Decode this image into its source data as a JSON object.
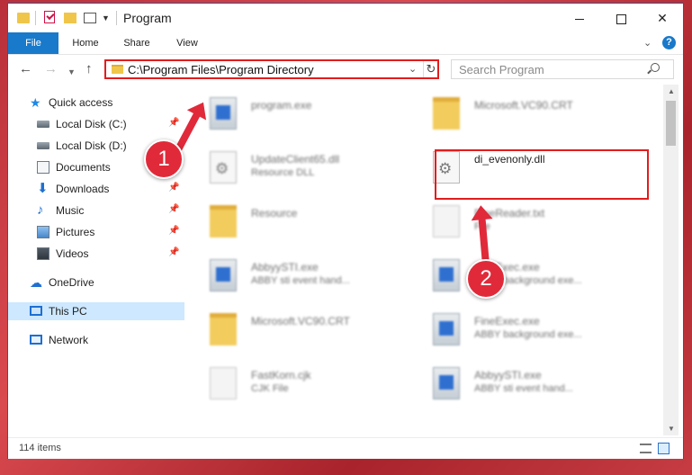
{
  "window": {
    "title": "Program"
  },
  "ribbon": {
    "tabs": [
      "File",
      "Home",
      "Share",
      "View"
    ]
  },
  "navigation": {
    "address": "C:\\Program Files\\Program Directory",
    "search_placeholder": "Search Program"
  },
  "sidebar": {
    "items": [
      {
        "label": "Quick access",
        "icon": "star-icon",
        "pinned": false
      },
      {
        "label": "Local Disk (C:)",
        "icon": "disk-icon",
        "pinned": true
      },
      {
        "label": "Local Disk (D:)",
        "icon": "disk-icon",
        "pinned": false
      },
      {
        "label": "Documents",
        "icon": "documents-icon",
        "pinned": true
      },
      {
        "label": "Downloads",
        "icon": "download-icon",
        "pinned": true
      },
      {
        "label": "Music",
        "icon": "music-icon",
        "pinned": true
      },
      {
        "label": "Pictures",
        "icon": "pictures-icon",
        "pinned": true
      },
      {
        "label": "Videos",
        "icon": "videos-icon",
        "pinned": true
      },
      {
        "label": "OneDrive",
        "icon": "cloud-icon",
        "pinned": false
      },
      {
        "label": "This PC",
        "icon": "computer-icon",
        "pinned": false,
        "selected": true
      },
      {
        "label": "Network",
        "icon": "network-icon",
        "pinned": false
      }
    ]
  },
  "files": [
    {
      "name": "program.exe",
      "desc": "",
      "icon": "exe-icon"
    },
    {
      "name": "Microsoft.VC90.CRT",
      "desc": "",
      "icon": "folder-icon"
    },
    {
      "name": "UpdateClient65.dll",
      "desc": "Resource DLL",
      "icon": "dll-icon"
    },
    {
      "name": "di_evenonly.dll",
      "desc": "",
      "icon": "dll-icon"
    },
    {
      "name": "Resource",
      "desc": "",
      "icon": "folder-icon"
    },
    {
      "name": "FineReader.txt",
      "desc": "File",
      "icon": "text-icon"
    },
    {
      "name": "AbbyySTI.exe",
      "desc": "ABBY sti event hand...",
      "icon": "exe-icon"
    },
    {
      "name": "FineExec.exe",
      "desc": "ABBY background exe...",
      "icon": "exe-icon"
    },
    {
      "name": "Microsoft.VC90.CRT",
      "desc": "",
      "icon": "folder-icon"
    },
    {
      "name": "FineExec.exe",
      "desc": "ABBY background exe...",
      "icon": "exe-icon"
    },
    {
      "name": "FastKorn.cjk",
      "desc": "CJK File",
      "icon": "text-icon"
    },
    {
      "name": "AbbyySTI.exe",
      "desc": "ABBY sti event hand...",
      "icon": "exe-icon"
    }
  ],
  "status": {
    "items_count": "114 items"
  },
  "annotations": {
    "step1": "1",
    "step2": "2"
  },
  "colors": {
    "accent": "#1979ca",
    "highlight": "#e21c1c",
    "badge": "#e02a3a"
  }
}
